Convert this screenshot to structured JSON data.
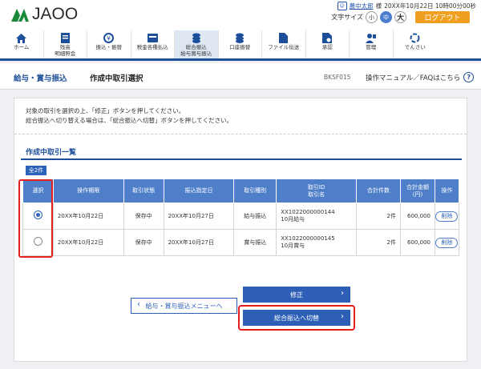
{
  "header": {
    "logo_text": "JAOO",
    "user_name": "農中太郎",
    "user_suffix": "様",
    "last_login": "20XX年10月22日 10時00分00秒",
    "font_size_label": "文字サイズ",
    "font_small": "小",
    "font_medium": "中",
    "font_large": "大",
    "logout_label": "ログアウト"
  },
  "nav": {
    "items": [
      {
        "label": "ホーム",
        "icon": "home-icon"
      },
      {
        "label": "残高\n明細照会",
        "icon": "passbook-icon"
      },
      {
        "label": "振込・振替",
        "icon": "transfer-icon"
      },
      {
        "label": "税金各種払込",
        "icon": "tax-icon"
      },
      {
        "label": "総合振込\n給与賞与振込",
        "icon": "coins-icon"
      },
      {
        "label": "口座振替",
        "icon": "coins-stack-icon"
      },
      {
        "label": "ファイル伝送",
        "icon": "file-icon"
      },
      {
        "label": "承認",
        "icon": "approval-icon"
      },
      {
        "label": "管理",
        "icon": "admin-icon"
      },
      {
        "label": "でんさい",
        "icon": "densai-icon"
      }
    ],
    "active_index": 4
  },
  "titlebar": {
    "section": "給与・賞与振込",
    "title": "作成中取引選択",
    "screen_code": "BKSF015",
    "help": "操作マニュアル／FAQはこちら"
  },
  "content": {
    "instruction_1": "対象の取引を選択の上、「修正」ボタンを押してください。",
    "instruction_2": "総合振込へ切り替える場合は、「総合振込へ切替」ボタンを押してください。",
    "section_title": "作成中取引一覧",
    "count_badge": "全2件"
  },
  "table": {
    "headers": {
      "select": "選択",
      "operation_date": "操作期限",
      "status": "取引状態",
      "transfer_date": "振込指定日",
      "type": "取引種別",
      "id_1": "取引ID",
      "id_2": "取引名",
      "total_count": "合計件数",
      "total_amount_1": "合計金額",
      "total_amount_2": "(円)",
      "operation": "操作"
    },
    "rows": [
      {
        "selected": true,
        "operation_date": "20XX年10月22日",
        "status": "保存中",
        "transfer_date": "20XX年10月27日",
        "type": "給与振込",
        "trans_id": "XX1022000000144",
        "trans_name": "10月給与",
        "count": "2件",
        "amount": "600,000",
        "action": "削除"
      },
      {
        "selected": false,
        "operation_date": "20XX年10月22日",
        "status": "保存中",
        "transfer_date": "20XX年10月27日",
        "type": "賞与振込",
        "trans_id": "XX1022000000145",
        "trans_name": "10月賞与",
        "count": "2件",
        "amount": "600,000",
        "action": "削除"
      }
    ]
  },
  "buttons": {
    "modify": "修正",
    "switch": "総合振込へ切替",
    "back": "給与・賞与振込メニューへ"
  },
  "colors": {
    "primary": "#2c5fb5",
    "nav_border": "#1d4e9a",
    "highlight_red": "#e41d1d",
    "logout": "#f0a020",
    "logo_green": "#1a8a3a"
  }
}
